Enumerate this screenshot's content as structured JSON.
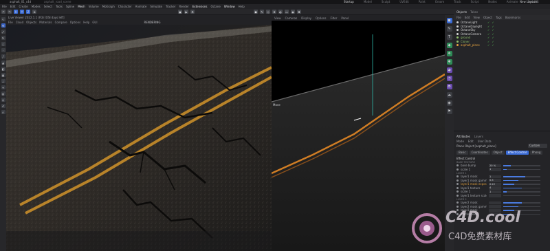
{
  "window": {
    "title": "asphalt_01_c4d",
    "subtitle": "asphalt_road_scene"
  },
  "layout_tabs": [
    "Startup",
    "Model",
    "Sculpt",
    "UVEdit",
    "Paint",
    "Groom",
    "Track",
    "Script",
    "Nodes",
    "Animate",
    "Redshift"
  ],
  "layout_active": "Startup",
  "new_layouts": "New Layouts",
  "menu": [
    "File",
    "Edit",
    "Create",
    "Modes",
    "Select",
    "Tools",
    "Spline",
    "Mesh",
    "Volume",
    "MoGraph",
    "Character",
    "Animate",
    "Simulate",
    "Tracker",
    "Render",
    "Extensions",
    "Octane",
    "Window",
    "Help"
  ],
  "menu_highlight": [
    "Mesh",
    "Extensions",
    "Window"
  ],
  "objects_panel": {
    "tabs": [
      "Objects",
      "Takes"
    ],
    "menu": [
      "File",
      "Edit",
      "View",
      "Object",
      "Tags",
      "Bookmarks"
    ],
    "items": [
      {
        "name": "OctaneLight",
        "color": "#d6d6d6"
      },
      {
        "name": "OctaneDaylight",
        "color": "#d6d6d6"
      },
      {
        "name": "OctaneSky",
        "color": "#d6d6d6"
      },
      {
        "name": "OctaneCamera",
        "color": "#d6d6d6"
      },
      {
        "name": "ground",
        "color": "#8fbf6a"
      },
      {
        "name": "Cloner",
        "color": "#8fbf6a"
      },
      {
        "name": "asphalt_plane",
        "color": "#e8a640"
      }
    ]
  },
  "viewport1": {
    "line1": [
      "Live Viewer 2022.1.1 (R3) [OSI days left]"
    ],
    "menu": [
      "File",
      "Cloud",
      "Objects",
      "Materials",
      "Compare",
      "Options",
      "Help",
      "GUI"
    ],
    "status": "RENDERING"
  },
  "viewport2": {
    "menu": [
      "View",
      "Cameras",
      "Display",
      "Options",
      "Filter",
      "Panel"
    ],
    "label": "Move"
  },
  "attributes": {
    "tabs": [
      "Attributes",
      "Layers"
    ],
    "menu": [
      "Mode",
      "Edit",
      "User Data"
    ],
    "object_name": "Plane Object [asphalt_plane]",
    "dropdown": "Custom",
    "subtabs": [
      "Basic",
      "Coordinates",
      "Object",
      "Effect Control",
      "Phong"
    ],
    "active_subtab": "Effect Control",
    "section": "Effect Control",
    "groups": [
      {
        "title": "BASE TEXTURE",
        "rows": [
          {
            "label": "base bump",
            "value": "20 %",
            "fill": 0.2
          },
          {
            "label": "scale 1",
            "value": "1",
            "fill": 0.1
          }
        ]
      },
      {
        "title": "LAYER 1",
        "rows": [
          {
            "label": "layer1 mask",
            "value": "1",
            "fill": 0.6
          },
          {
            "label": "layer1 mask gamma",
            "value": "0.5",
            "fill": 0.4
          },
          {
            "label": "layer1 mask exposure",
            "value": "0.22",
            "fill": 0.3,
            "highlight": true
          },
          {
            "label": "layer1 texture",
            "value": "4",
            "fill": 0.5
          },
          {
            "label": "scale 1",
            "value": "1",
            "fill": 0.1
          },
          {
            "label": "layer1 texture scale",
            "value": "",
            "fill": 0.0
          }
        ]
      },
      {
        "title": "LAYER 2",
        "rows": [
          {
            "label": "layer2 mask",
            "value": "",
            "fill": 0.5
          },
          {
            "label": "layer2 mask gamma",
            "value": "",
            "fill": 0.4
          },
          {
            "label": "layer2 mask",
            "value": "",
            "fill": 0.3
          },
          {
            "label": "cracks mask",
            "value": "",
            "fill": 0.2
          }
        ]
      }
    ]
  },
  "watermark": {
    "main": "C4D.cool",
    "sub": "C4D免费素材库"
  }
}
